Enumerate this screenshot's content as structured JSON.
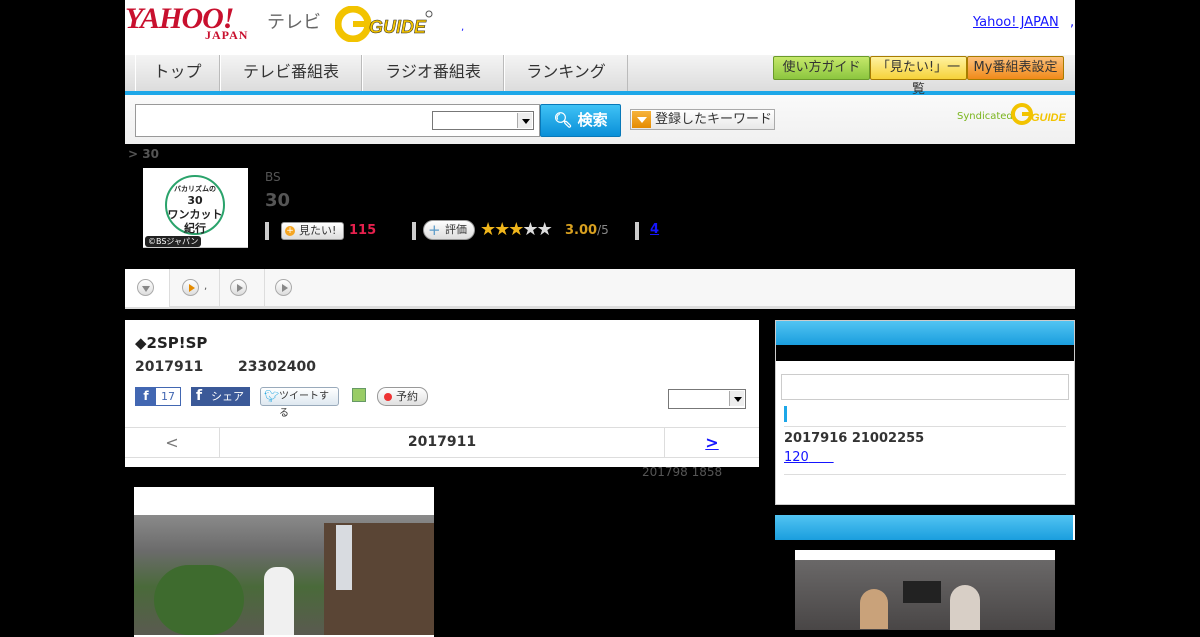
{
  "header": {
    "yahoo_logo": "YAHOO!",
    "japan_logo": "JAPAN",
    "tv_label": "テレビ",
    "gguide_logo": "G-GUIDE",
    "yahoo_japan_link": "Yahoo! JAPAN",
    "link_sep": ",",
    "header_dot": ","
  },
  "nav": {
    "tabs": [
      "トップ",
      "テレビ番組表",
      "ラジオ番組表",
      "ランキング"
    ],
    "buttons": [
      "使い方ガイド",
      "「見たい!」一覧",
      "My番組表設定"
    ]
  },
  "search": {
    "input_value": "",
    "button_label": "検索",
    "keyword_button": "登録したキーワード",
    "syndicated": "Syndicated"
  },
  "breadcrumb": "> 30",
  "program": {
    "channel": "BS",
    "title": "30",
    "thumb_text": [
      "バカリズムの",
      "30",
      "ワンカット",
      "紀行"
    ],
    "thumb_caption": "©BSジャパン",
    "mitai_label": "見たい!",
    "mitai_count": "115",
    "hyoka_label": "評価",
    "rating": 3,
    "score": "3.00",
    "score_max": "/5",
    "review_count": "4"
  },
  "tabs2": {
    "second_tab_dot": ","
  },
  "episode": {
    "title": "◆2SP!SP",
    "date": "2017911",
    "time": "23302400",
    "like_count": "17",
    "share_label": "シェア",
    "tweet_label": "ツイートする",
    "reserve_label": "予約",
    "prev_label": "<",
    "current_label": "2017911",
    "next_label": ">",
    "updated": "201798  1858"
  },
  "sidebar": {
    "next_date": "2017916  21002255",
    "link_text": "120"
  },
  "colors": {
    "accent": "#1da7e8",
    "brand_red": "#c8102e",
    "mitai_count": "#e6204d",
    "star": "#f1b61b"
  }
}
